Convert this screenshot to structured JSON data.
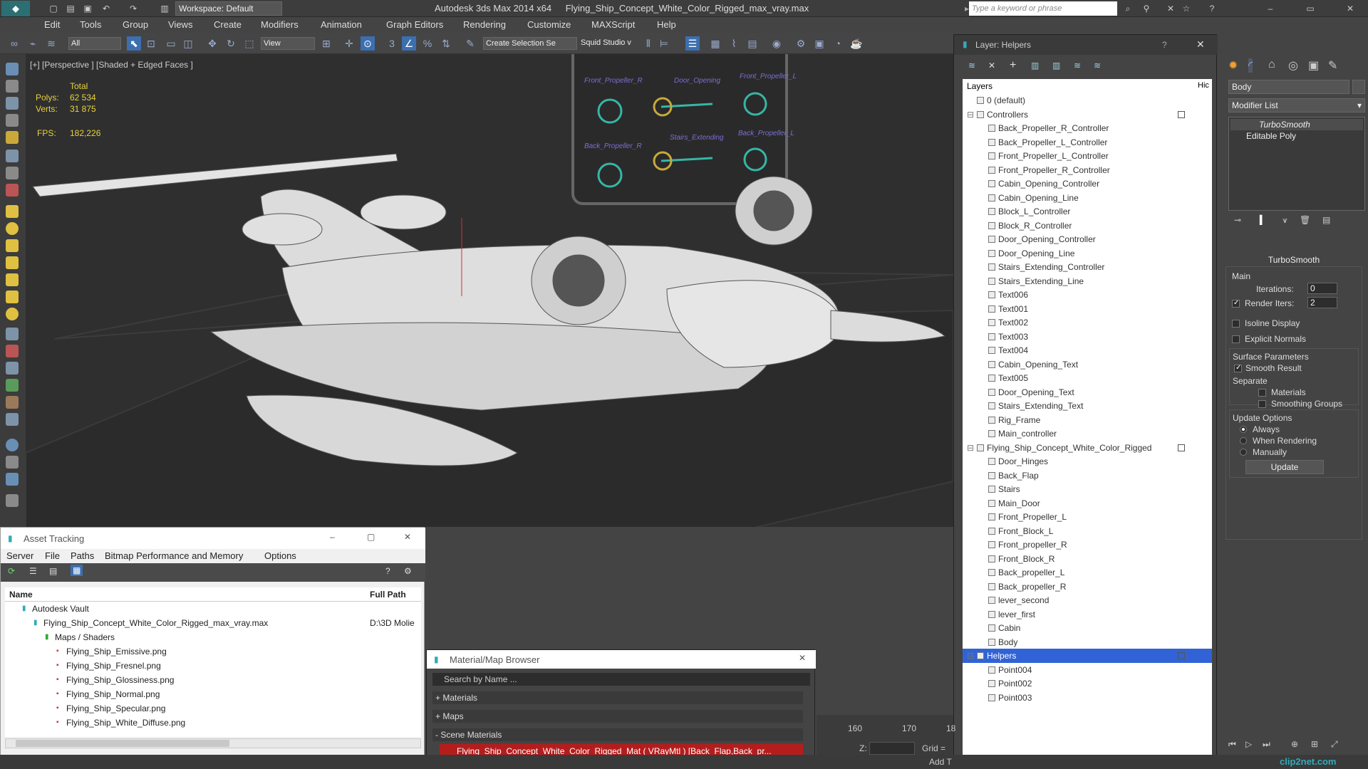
{
  "title": {
    "app_name": "Autodesk 3ds Max  2014 x64",
    "file_name": "Flying_Ship_Concept_White_Color_Rigged_max_vray.max",
    "workspace": "Workspace: Default",
    "search_placeholder": "Type a keyword or phrase"
  },
  "menu": [
    "Edit",
    "Tools",
    "Group",
    "Views",
    "Create",
    "Modifiers",
    "Animation",
    "Graph Editors",
    "Rendering",
    "Customize",
    "MAXScript",
    "Help"
  ],
  "toolbar": {
    "filter_value": "All",
    "coord_value": "View",
    "selection_set": "Create Selection Se",
    "squid": "Squid Studio v"
  },
  "viewport": {
    "label": "[+] [Perspective ] [Shaded + Edged Faces ]",
    "stats_total": "Total",
    "polys_label": "Polys:",
    "polys_value": "62 534",
    "verts_label": "Verts:",
    "verts_value": "31 875",
    "fps_label": "FPS:",
    "fps_value": "182,226",
    "rig_labels": [
      "Front_Propeller_R",
      "Door_Opening",
      "Front_Propeller_L",
      "Back_Propeller_R",
      "Stairs_Extending",
      "Back_Propeller_L"
    ]
  },
  "layers": {
    "title": "Layer: Helpers",
    "help": "?",
    "col_layers": "Layers",
    "col_hide": "Hic",
    "rows": [
      {
        "label": "0 (default)",
        "indent": 1,
        "group": false
      },
      {
        "label": "Controllers",
        "indent": 1,
        "group": true
      },
      {
        "label": "Back_Propeller_R_Controller",
        "indent": 2
      },
      {
        "label": "Back_Propeller_L_Controller",
        "indent": 2
      },
      {
        "label": "Front_Propeller_L_Controller",
        "indent": 2
      },
      {
        "label": "Front_Propeller_R_Controller",
        "indent": 2
      },
      {
        "label": "Cabin_Opening_Controller",
        "indent": 2
      },
      {
        "label": "Cabin_Opening_Line",
        "indent": 2
      },
      {
        "label": "Block_L_Controller",
        "indent": 2
      },
      {
        "label": "Block_R_Controller",
        "indent": 2
      },
      {
        "label": "Door_Opening_Controller",
        "indent": 2
      },
      {
        "label": "Door_Opening_Line",
        "indent": 2
      },
      {
        "label": "Stairs_Extending_Controller",
        "indent": 2
      },
      {
        "label": "Stairs_Extending_Line",
        "indent": 2
      },
      {
        "label": "Text006",
        "indent": 2
      },
      {
        "label": "Text001",
        "indent": 2
      },
      {
        "label": "Text002",
        "indent": 2
      },
      {
        "label": "Text003",
        "indent": 2
      },
      {
        "label": "Text004",
        "indent": 2
      },
      {
        "label": "Cabin_Opening_Text",
        "indent": 2
      },
      {
        "label": "Text005",
        "indent": 2
      },
      {
        "label": "Door_Opening_Text",
        "indent": 2
      },
      {
        "label": "Stairs_Extending_Text",
        "indent": 2
      },
      {
        "label": "Rig_Frame",
        "indent": 2
      },
      {
        "label": "Main_controller",
        "indent": 2
      },
      {
        "label": "Flying_Ship_Concept_White_Color_Rigged",
        "indent": 1,
        "group": true
      },
      {
        "label": "Door_Hinges",
        "indent": 2
      },
      {
        "label": "Back_Flap",
        "indent": 2
      },
      {
        "label": "Stairs",
        "indent": 2
      },
      {
        "label": "Main_Door",
        "indent": 2
      },
      {
        "label": "Front_Propeller_L",
        "indent": 2
      },
      {
        "label": "Front_Block_L",
        "indent": 2
      },
      {
        "label": "Front_propeller_R",
        "indent": 2
      },
      {
        "label": "Front_Block_R",
        "indent": 2
      },
      {
        "label": "Back_propeller_L",
        "indent": 2
      },
      {
        "label": "Back_propeller_R",
        "indent": 2
      },
      {
        "label": "lever_second",
        "indent": 2
      },
      {
        "label": "lever_first",
        "indent": 2
      },
      {
        "label": "Cabin",
        "indent": 2
      },
      {
        "label": "Body",
        "indent": 2
      },
      {
        "label": "Helpers",
        "indent": 1,
        "group": true,
        "selected": true
      },
      {
        "label": "Point004",
        "indent": 2
      },
      {
        "label": "Point002",
        "indent": 2
      },
      {
        "label": "Point003",
        "indent": 2
      }
    ]
  },
  "command_panel": {
    "object_name": "Body",
    "modifier_list": "Modifier List",
    "stack": [
      "TurboSmooth",
      "Editable Poly"
    ],
    "rollout_title": "TurboSmooth",
    "main_label": "Main",
    "iterations_label": "Iterations:",
    "iterations_value": "0",
    "render_iters_label": "Render Iters:",
    "render_iters_value": "2",
    "isoline": "Isoline Display",
    "explicit_normals": "Explicit Normals",
    "surface_params": "Surface Parameters",
    "smooth_result": "Smooth Result",
    "separate": "Separate",
    "materials": "Materials",
    "smoothing_groups": "Smoothing Groups",
    "update_options": "Update Options",
    "always": "Always",
    "when_rendering": "When Rendering",
    "manually": "Manually",
    "update_button": "Update"
  },
  "asset_tracking": {
    "title": "Asset Tracking",
    "menu": [
      "Server",
      "File",
      "Paths",
      "Bitmap Performance and Memory",
      "Options"
    ],
    "col_name": "Name",
    "col_path": "Full Path",
    "rows": [
      {
        "label": "Autodesk Vault",
        "indent": 1,
        "path": ""
      },
      {
        "label": "Flying_Ship_Concept_White_Color_Rigged_max_vray.max",
        "indent": 2,
        "path": "D:\\3D Molie"
      },
      {
        "label": "Maps / Shaders",
        "indent": 3,
        "path": ""
      },
      {
        "label": "Flying_Ship_Emissive.png",
        "indent": 4,
        "path": ""
      },
      {
        "label": "Flying_Ship_Fresnel.png",
        "indent": 4,
        "path": ""
      },
      {
        "label": "Flying_Ship_Glossiness.png",
        "indent": 4,
        "path": ""
      },
      {
        "label": "Flying_Ship_Normal.png",
        "indent": 4,
        "path": ""
      },
      {
        "label": "Flying_Ship_Specular.png",
        "indent": 4,
        "path": ""
      },
      {
        "label": "Flying_Ship_White_Diffuse.png",
        "indent": 4,
        "path": ""
      }
    ]
  },
  "material_browser": {
    "title": "Material/Map Browser",
    "search_placeholder": "Search by Name ...",
    "sections": [
      "+ Materials",
      "+ Maps",
      "- Scene Materials"
    ],
    "scene_material": "Flying_Ship_Concept_White_Color_Rigged_Mat ( VRayMtl ) [Back_Flap,Back_pr..."
  },
  "timeline": {
    "ticks": [
      "160",
      "170",
      "18"
    ],
    "z_label": "Z:",
    "grid_label": "Grid =",
    "add_t": "Add T"
  },
  "watermark": "clip2net.com"
}
